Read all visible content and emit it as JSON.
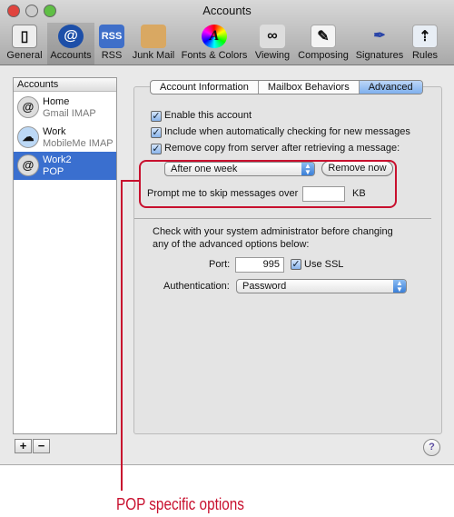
{
  "window": {
    "title": "Accounts"
  },
  "toolbar": [
    {
      "label": "General",
      "icon": "switch-icon"
    },
    {
      "label": "Accounts",
      "icon": "at-icon",
      "selected": true
    },
    {
      "label": "RSS",
      "icon": "rss-icon"
    },
    {
      "label": "Junk Mail",
      "icon": "junk-mail-icon"
    },
    {
      "label": "Fonts & Colors",
      "icon": "font-color-icon"
    },
    {
      "label": "Viewing",
      "icon": "glasses-icon"
    },
    {
      "label": "Composing",
      "icon": "pencil-icon"
    },
    {
      "label": "Signatures",
      "icon": "pen-icon"
    },
    {
      "label": "Rules",
      "icon": "rules-icon"
    }
  ],
  "sidebar": {
    "header": "Accounts",
    "accounts": [
      {
        "name": "Home",
        "type": "Gmail IMAP"
      },
      {
        "name": "Work",
        "type": "MobileMe IMAP"
      },
      {
        "name": "Work2",
        "type": "POP",
        "selected": true
      }
    ],
    "add": "+",
    "remove": "−"
  },
  "tabs": [
    {
      "label": "Account Information"
    },
    {
      "label": "Mailbox Behaviors"
    },
    {
      "label": "Advanced",
      "selected": true
    }
  ],
  "advanced": {
    "enable": "Enable this account",
    "include": "Include when automatically checking for new messages",
    "remove_copy": "Remove copy from server after retrieving a message:",
    "remove_when": "After one week",
    "remove_now": "Remove now",
    "prompt": "Prompt me to skip messages over",
    "prompt_value": "",
    "kb": "KB",
    "warn1": "Check with your system administrator before changing",
    "warn2": "any of the advanced options below:",
    "port_label": "Port:",
    "port": "995",
    "ssl": "Use SSL",
    "auth_label": "Authentication:",
    "auth": "Password"
  },
  "help": "?",
  "callout": "POP specific options",
  "colors": {
    "accent": "#3a6fcf",
    "callout": "#c8102e"
  }
}
